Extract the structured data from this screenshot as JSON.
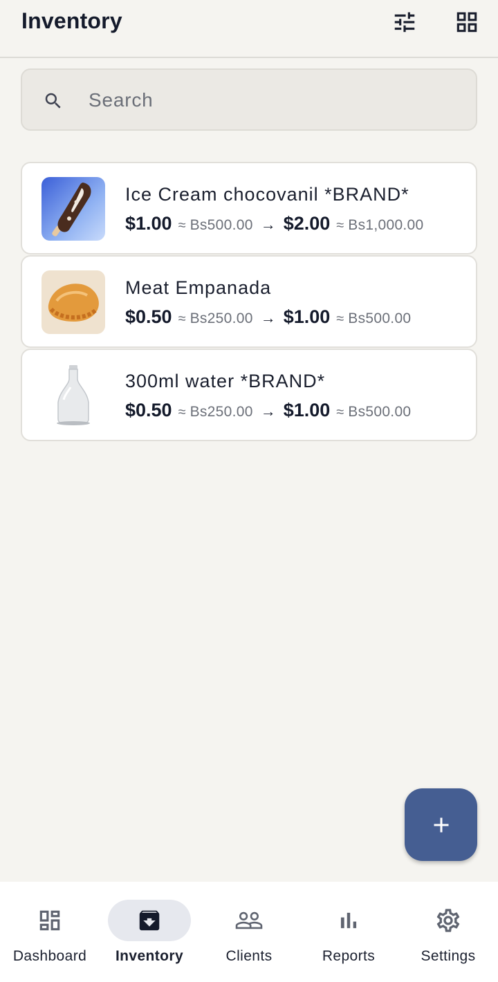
{
  "header": {
    "title": "Inventory"
  },
  "icons": {
    "filter": "tune-sliders-icon",
    "view_toggle": "grid-view-icon",
    "search": "search-icon",
    "add": "plus-icon"
  },
  "search": {
    "placeholder": "Search",
    "value": ""
  },
  "products": [
    {
      "name": "Ice Cream chocovanil *BRAND*",
      "cost_usd": "$1.00",
      "cost_bs": "Bs500.00",
      "price_usd": "$2.00",
      "price_bs": "Bs1,000.00",
      "image": "ice-cream-bar"
    },
    {
      "name": "Meat Empanada",
      "cost_usd": "$0.50",
      "cost_bs": "Bs250.00",
      "price_usd": "$1.00",
      "price_bs": "Bs500.00",
      "image": "empanada"
    },
    {
      "name": "300ml water *BRAND*",
      "cost_usd": "$0.50",
      "cost_bs": "Bs250.00",
      "price_usd": "$1.00",
      "price_bs": "Bs500.00",
      "image": "water-bottle"
    }
  ],
  "symbols": {
    "approx": "≈",
    "arrow": "→"
  },
  "nav": {
    "active": "Inventory",
    "items": [
      {
        "label": "Dashboard",
        "icon": "dashboard-icon"
      },
      {
        "label": "Inventory",
        "icon": "inventory-box-icon"
      },
      {
        "label": "Clients",
        "icon": "people-icon"
      },
      {
        "label": "Reports",
        "icon": "bar-chart-icon"
      },
      {
        "label": "Settings",
        "icon": "gear-icon"
      }
    ]
  },
  "colors": {
    "background": "#f5f4f0",
    "fab": "#455e92",
    "active_pill": "#e6e8ee",
    "text_primary": "#141a2b",
    "text_secondary": "#6b6f78"
  }
}
